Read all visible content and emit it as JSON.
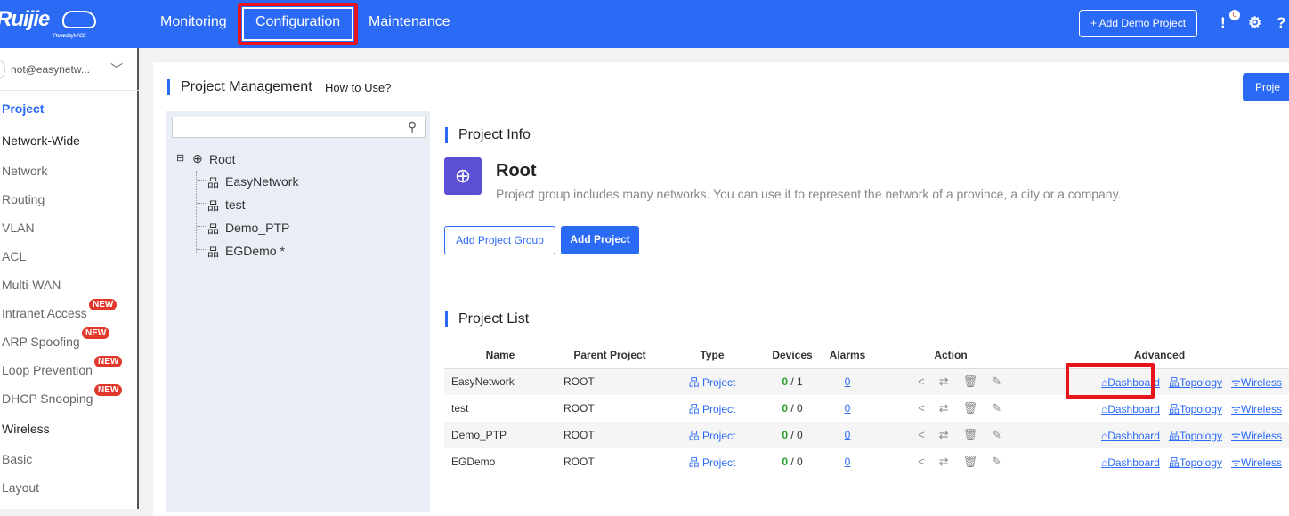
{
  "header": {
    "logo": "Ruijie",
    "logo_sub": "Powered by MACC",
    "nav": [
      "Monitoring",
      "Configuration",
      "Maintenance"
    ],
    "active_nav": "Configuration",
    "add_demo": "+ Add Demo Project",
    "alert_count": "0",
    "brand_color": "#2b6af5"
  },
  "sidebar": {
    "user": "not@easynetw...",
    "items": [
      {
        "label": "Project",
        "type": "active"
      },
      {
        "label": "Network-Wide",
        "type": "heading"
      },
      {
        "label": "Network"
      },
      {
        "label": "Routing"
      },
      {
        "label": "VLAN"
      },
      {
        "label": "ACL"
      },
      {
        "label": "Multi-WAN"
      },
      {
        "label": "Intranet Access",
        "badge": "NEW"
      },
      {
        "label": "ARP Spoofing",
        "badge": "NEW"
      },
      {
        "label": "Loop Prevention",
        "badge": "NEW"
      },
      {
        "label": "DHCP Snooping",
        "badge": "NEW"
      },
      {
        "label": "Wireless",
        "type": "heading"
      },
      {
        "label": "Basic"
      },
      {
        "label": "Layout"
      }
    ]
  },
  "main": {
    "title": "Project Management",
    "how_to": "How to Use?",
    "project_btn": "Proje",
    "tree": {
      "search_placeholder": "",
      "root": "Root",
      "children": [
        "EasyNetwork",
        "test",
        "Demo_PTP",
        "EGDemo *"
      ]
    },
    "info": {
      "title": "Project Info",
      "name": "Root",
      "desc": "Project group includes many networks. You can use it to represent the network of a province, a city or a company.",
      "add_group": "Add Project Group",
      "add_project": "Add Project"
    },
    "list": {
      "title": "Project List",
      "columns": [
        "Name",
        "Parent Project",
        "Type",
        "Devices",
        "Alarms",
        "Action",
        "Advanced"
      ],
      "rows": [
        {
          "name": "EasyNetwork",
          "parent": "ROOT",
          "type": "Project",
          "online": "0",
          "devices": " / 1",
          "alarms": "0"
        },
        {
          "name": "test",
          "parent": "ROOT",
          "type": "Project",
          "online": "0",
          "devices": " / 0",
          "alarms": "0"
        },
        {
          "name": "Demo_PTP",
          "parent": "ROOT",
          "type": "Project",
          "online": "0",
          "devices": " / 0",
          "alarms": "0"
        },
        {
          "name": "EGDemo",
          "parent": "ROOT",
          "type": "Project",
          "online": "0",
          "devices": " / 0",
          "alarms": "0"
        }
      ],
      "links": {
        "dashboard": "Dashboard",
        "topology": "Topology",
        "wireless": "Wireless"
      }
    }
  }
}
